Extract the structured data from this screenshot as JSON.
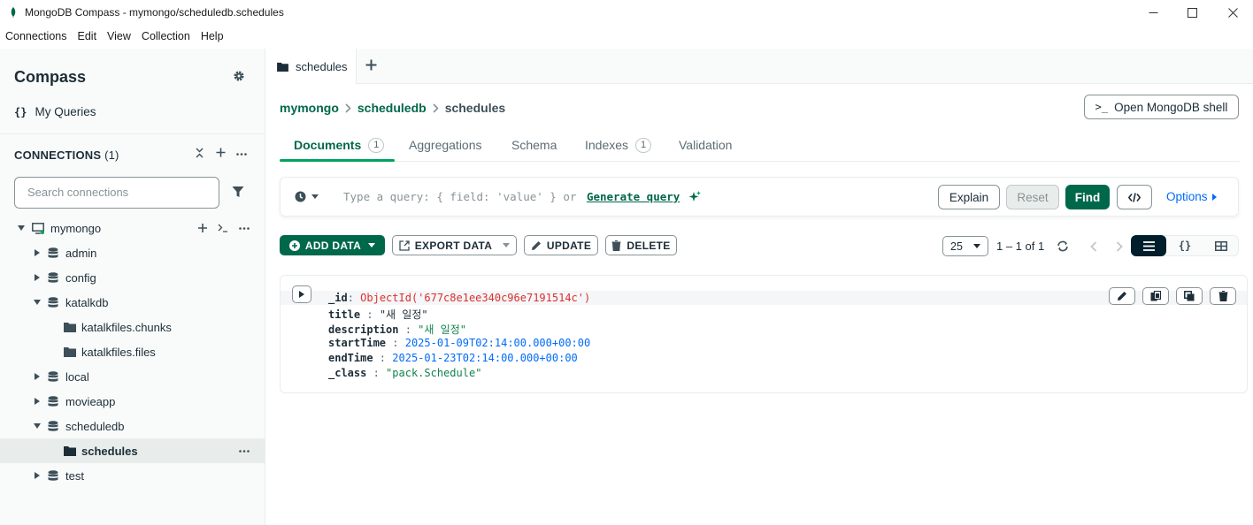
{
  "window": {
    "title": "MongoDB Compass - mymongo/scheduledb.schedules"
  },
  "menu": [
    "Connections",
    "Edit",
    "View",
    "Collection",
    "Help"
  ],
  "sidebar": {
    "brand": "Compass",
    "my_queries": "My Queries",
    "connections_label": "CONNECTIONS",
    "connections_count": "(1)",
    "search_placeholder": "Search connections",
    "tree": {
      "connection": "mymongo",
      "databases": [
        {
          "name": "admin",
          "expanded": false
        },
        {
          "name": "config",
          "expanded": false
        },
        {
          "name": "katalkdb",
          "expanded": true,
          "collections": [
            "katalkfiles.chunks",
            "katalkfiles.files"
          ]
        },
        {
          "name": "local",
          "expanded": false
        },
        {
          "name": "movieapp",
          "expanded": false
        },
        {
          "name": "scheduledb",
          "expanded": true,
          "collections": [
            "schedules"
          ]
        },
        {
          "name": "test",
          "expanded": false
        }
      ],
      "selected": "schedules"
    }
  },
  "tabs": {
    "active": "schedules"
  },
  "breadcrumb": {
    "connection": "mymongo",
    "database": "scheduledb",
    "collection": "schedules"
  },
  "shell_button": "Open MongoDB shell",
  "subtabs": [
    {
      "label": "Documents",
      "badge": "1"
    },
    {
      "label": "Aggregations",
      "badge": ""
    },
    {
      "label": "Schema",
      "badge": ""
    },
    {
      "label": "Indexes",
      "badge": "1"
    },
    {
      "label": "Validation",
      "badge": ""
    }
  ],
  "query": {
    "placeholder": "Type a query: { field: 'value' } or",
    "generate": "Generate query",
    "explain": "Explain",
    "reset": "Reset",
    "find": "Find",
    "options": "Options"
  },
  "actions": {
    "add": "ADD DATA",
    "export": "EXPORT DATA",
    "update": "UPDATE",
    "delete": "DELETE"
  },
  "pager": {
    "page_size": "25",
    "range": "1 – 1 of 1"
  },
  "document": {
    "fields": [
      {
        "key": "_id",
        "value": "ObjectId('677c8e1ee340c96e7191514c')",
        "kind": "oid"
      },
      {
        "key": "title",
        "value": "\"새 일정\"",
        "kind": "plain"
      },
      {
        "key": "description",
        "value": "\"새 일정\"",
        "kind": "str"
      },
      {
        "key": "startTime",
        "value": "2025-01-09T02:14:00.000+00:00",
        "kind": "date"
      },
      {
        "key": "endTime",
        "value": "2025-01-23T02:14:00.000+00:00",
        "kind": "date"
      },
      {
        "key": "_class",
        "value": "\"pack.Schedule\"",
        "kind": "str"
      }
    ]
  }
}
